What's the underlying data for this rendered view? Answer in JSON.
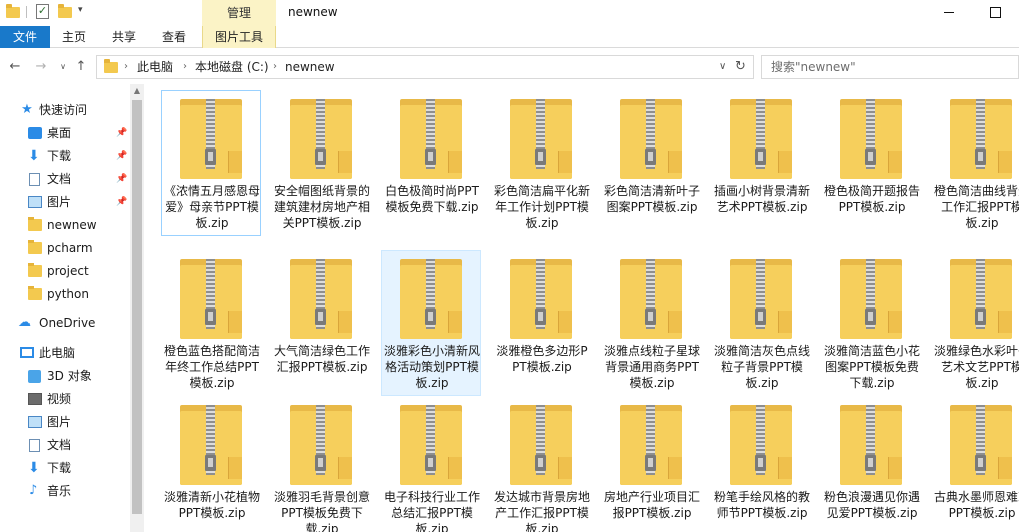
{
  "window": {
    "title": "newnew",
    "context_tab": "管理",
    "minimize_glyph": "—",
    "maximize_glyph": "☐",
    "quick_access_dropdown": "▾"
  },
  "ribbon": {
    "tabs": [
      "文件",
      "主页",
      "共享",
      "查看",
      "图片工具"
    ]
  },
  "address": {
    "back_glyph": "←",
    "forward_glyph": "→",
    "up_glyph": "↑",
    "crumbs": [
      "此电脑",
      "本地磁盘 (C:)",
      "newnew"
    ],
    "sep_glyph": "›",
    "dropdown_glyph": "∨",
    "refresh_glyph": "↻",
    "search_placeholder": "搜索\"newnew\""
  },
  "nav": {
    "quick_access": "快速访问",
    "items": [
      "桌面",
      "下载",
      "文档",
      "图片",
      "newnew",
      "pcharm",
      "project",
      "python"
    ],
    "onedrive": "OneDrive",
    "this_pc": "此电脑",
    "pc_items": [
      "3D 对象",
      "视频",
      "图片",
      "文档",
      "下载",
      "音乐"
    ],
    "pin_glyph": "📌"
  },
  "files": [
    "《浓情五月感恩母爱》母亲节PPT模板.zip",
    "安全帽图纸背景的建筑建材房地产相关PPT模板.zip",
    "白色极简时尚PPT模板免费下载.zip",
    "彩色简洁扁平化新年工作计划PPT模板.zip",
    "彩色简洁清新叶子图案PPT模板.zip",
    "插画小树背景清新艺术PPT模板.zip",
    "橙色极简开题报告PPT模板.zip",
    "橙色简洁曲线背景工作汇报PPT模板.zip",
    "橙色蓝色搭配简洁年终工作总结PPT模板.zip",
    "大气简洁绿色工作汇报PPT模板.zip",
    "淡雅彩色小清新风格活动策划PPT模板.zip",
    "淡雅橙色多边形PPT模板.zip",
    "淡雅点线粒子星球背景通用商务PPT模板.zip",
    "淡雅简洁灰色点线粒子背景PPT模板.zip",
    "淡雅简洁蓝色小花图案PPT模板免费下载.zip",
    "淡雅绿色水彩叶子艺术文艺PPT模板.zip",
    "淡雅清新小花植物PPT模板.zip",
    "淡雅羽毛背景创意PPT模板免费下载.zip",
    "电子科技行业工作总结汇报PPT模板.zip",
    "发达城市背景房地产工作汇报PPT模板.zip",
    "房地产行业项目汇报PPT模板.zip",
    "粉笔手绘风格的教师节PPT模板.zip",
    "粉色浪漫遇见你遇见爱PPT模板.zip",
    "古典水墨师恩难忘PPT模板.zip"
  ],
  "colors": {
    "file_tab": "#1979ca",
    "context_tab": "#fbf3c6",
    "selection": "#e5f3ff",
    "folder": "#f6cf5c"
  }
}
